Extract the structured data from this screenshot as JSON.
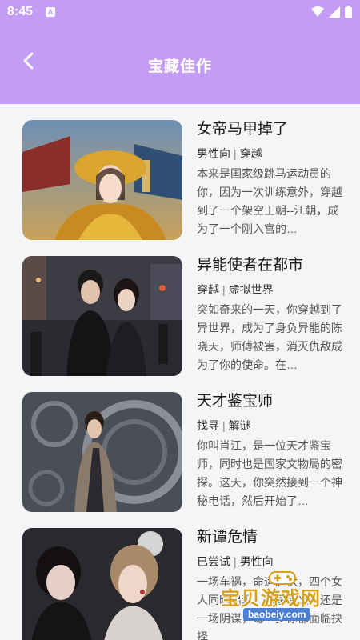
{
  "status_bar": {
    "time": "8:45",
    "notification_badge": "A",
    "icons": [
      "wifi-icon",
      "signal-icon",
      "battery-icon"
    ]
  },
  "app_bar": {
    "title": "宝藏佳作",
    "back_icon": "chevron-left-icon"
  },
  "colors": {
    "accent": "#c39cf5",
    "background": "#f5f5f7"
  },
  "stories": [
    {
      "title": "女帝马甲掉了",
      "tags": [
        "男性向",
        "穿越"
      ],
      "description": "本来是国家级跳马运动员的你，因为一次训练意外，穿越到了一个架空王朝--江朝，成为了一个刚入宫的…"
    },
    {
      "title": "异能使者在都市",
      "tags": [
        "穿越",
        "虚拟世界"
      ],
      "description": "突如奇来的一天，你穿越到了异世界，成为了身负异能的陈晓天，师傅被害，消灭仇敌成为了你的使命。在…"
    },
    {
      "title": "天才鉴宝师",
      "tags": [
        "找寻",
        "解谜"
      ],
      "description": "你叫肖江，是一位天才鉴宝师，同时也是国家文物局的密探。这天，你突然接到一个神秘电话，然后开始了…"
    },
    {
      "title": "新谭危情",
      "tags": [
        "已尝试",
        "男性向"
      ],
      "description": "一场车祸，命运起伏，四个女人同时出现，两家深义重还是一场阴谋，每一步你都面临抉择"
    }
  ],
  "watermark": {
    "text": "宝贝游戏网",
    "url": "baobeiy.com"
  }
}
